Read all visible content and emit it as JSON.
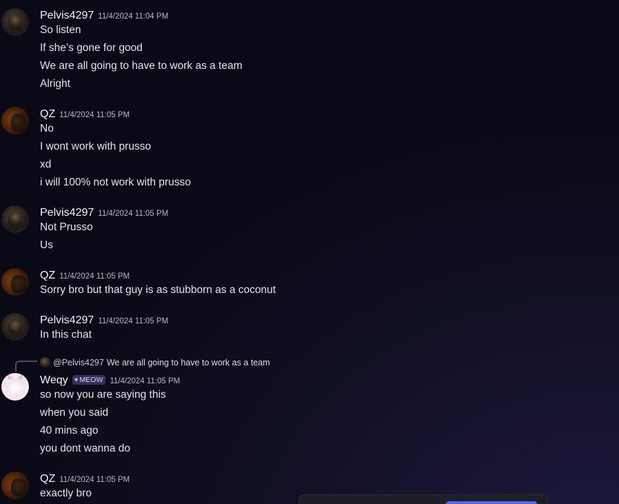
{
  "messages": [
    {
      "username": "Pelvis4297",
      "timestamp": "11/4/2024 11:04 PM",
      "lines": [
        "So listen",
        "If she’s gone for good",
        "We are all going to have to work as a team",
        "Alright"
      ]
    },
    {
      "username": "QZ",
      "timestamp": "11/4/2024 11:05 PM",
      "lines": [
        "No",
        "I wont work with prusso",
        "xd",
        "i will 100% not work with prusso"
      ]
    },
    {
      "username": "Pelvis4297",
      "timestamp": "11/4/2024 11:05 PM",
      "lines": [
        "Not Prusso",
        "Us"
      ]
    },
    {
      "username": "QZ",
      "timestamp": "11/4/2024 11:05 PM",
      "lines": [
        "Sorry bro but that guy is as stubborn as a coconut"
      ]
    },
    {
      "username": "Pelvis4297",
      "timestamp": "11/4/2024 11:05 PM",
      "lines": [
        "In this chat"
      ]
    },
    {
      "username": "Weqy",
      "badge": "MEOW",
      "timestamp": "11/4/2024 11:05 PM",
      "reply": {
        "author": "@Pelvis4297",
        "text": "We are all going to have to work as a team"
      },
      "lines": [
        "so now you are saying this",
        "when you said",
        "40 mins ago",
        "you dont wanna do"
      ]
    },
    {
      "username": "QZ",
      "timestamp": "11/4/2024 11:05 PM",
      "lines": [
        "exactly bro"
      ]
    }
  ],
  "icons": {
    "badge_icon": "heart-icon"
  },
  "colors": {
    "username": "#f2f3f5",
    "timestamp": "#b5bac1",
    "message_text": "#e3e5e8",
    "badge_bg": "#3f3a66",
    "accent": "#5865f2"
  }
}
